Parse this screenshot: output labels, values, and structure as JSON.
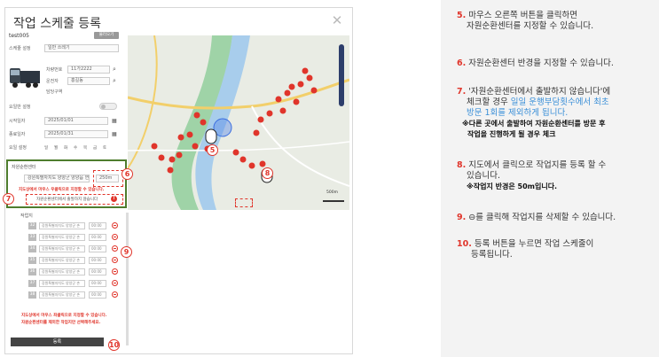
{
  "modal": {
    "title": "작업 스케줄 등록",
    "close": "✕"
  },
  "form": {
    "vehicle_id": "test005",
    "load_button": "불러오기",
    "schedule_type_label": "스케줄 설정",
    "schedule_type_value": "일반 쓰레기",
    "vehicle_no_label": "차량번호",
    "vehicle_no_value": "11가2222",
    "driver_label": "운전자",
    "driver_value": "홍길동",
    "area_label": "담당구역",
    "area_value": "",
    "repeat_label": "요일반 설정",
    "start_label": "시작일자",
    "start_value": "2025/01/01",
    "end_label": "종료일자",
    "end_value": "2025/01/31",
    "days_label": "요일 설정",
    "days": [
      "일",
      "월",
      "화",
      "수",
      "목",
      "금",
      "토"
    ],
    "center_label": "자원순환센터",
    "center_value": "강원특별자치도 양양군 양양읍 연",
    "center_radius": "250m",
    "center_note": "지도상에서 마우스 우클릭으로 지정할 수 있습니다.",
    "no_depart_label": "자원순환센터에서 출발하지 않습니다",
    "waypoints_label": "작업지",
    "waypoints": [
      {
        "num": "32",
        "addr": "강원특별자치도 양양군 손",
        "time": "00:00"
      },
      {
        "num": "33",
        "addr": "강원특별자치도 양양군 손",
        "time": "00:00"
      },
      {
        "num": "34",
        "addr": "강원특별자치도 양양군 손",
        "time": "00:00"
      },
      {
        "num": "35",
        "addr": "강원특별자치도 양양군 손",
        "time": "00:00"
      },
      {
        "num": "36",
        "addr": "강원특별자치도 양양군 손",
        "time": "00:00"
      },
      {
        "num": "37",
        "addr": "강원특별자치도 양양군 손",
        "time": "00:00"
      },
      {
        "num": "38",
        "addr": "강원특별자치도 양양군 손",
        "time": "00:00"
      }
    ],
    "bottom_note_1": "지도상에서 마우스 좌클릭으로 지정할 수 있습니다.",
    "bottom_note_2": "자원순환센터를 제외한 작업지만 선택해주세요.",
    "submit": "등록"
  },
  "map": {
    "scale": "500m"
  },
  "annotations": {
    "n5": "5",
    "n6": "6",
    "n7": "7",
    "n8": "8",
    "n9": "9",
    "n10": "10"
  },
  "instructions": {
    "s5_n": "5.",
    "s5_l1": "마우스 오른쪽 버튼을 클릭하면",
    "s5_l2": "자원순환센터를 지정할 수 있습니다.",
    "s6_n": "6.",
    "s6_l1": "자원순환센터 반경을 지정할 수 있습니다.",
    "s7_n": "7.",
    "s7_l1": "'자원순환센터에서 출발하지 않습니다'에",
    "s7_l2a": "체크할 경우 ",
    "s7_l2b": "일일 운행부담횟수에서 최초",
    "s7_l3": "방문 1회를 제외하게 됩니다.",
    "s7_l4": "※다른 곳에서 출발하여 자원순환센터를 방문 후",
    "s7_l5": "작업을 진행하게 될 경우 체크",
    "s8_n": "8.",
    "s8_l1": "지도에서 클릭으로 작업지를 등록 할 수",
    "s8_l2": "있습니다.",
    "s8_l3": "※작업지 반경은 50m입니다.",
    "s9_n": "9.",
    "s9_l1": "⊖를 클릭해 작업지를 삭제할 수 있습니다.",
    "s10_n": "10.",
    "s10_l1": "등록 버튼을 누르면 작업 스케줄이",
    "s10_l2": "등록됩니다."
  },
  "colors": {
    "accent_red": "#e0352b",
    "frame_green": "#4e7d2e",
    "link_blue": "#3a8fd8"
  }
}
